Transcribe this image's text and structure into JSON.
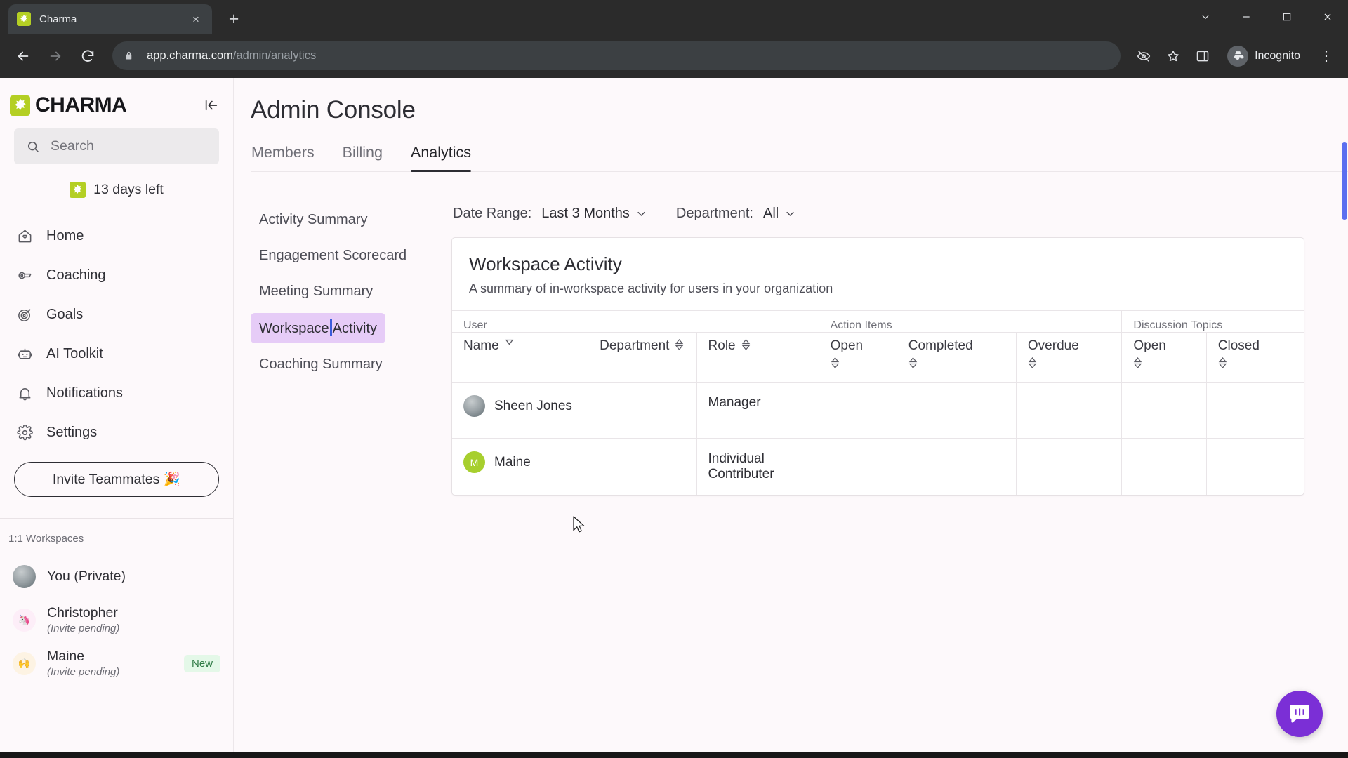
{
  "browser": {
    "tab_title": "Charma",
    "tab_close": "×",
    "new_tab": "+",
    "url_host": "app.charma.com",
    "url_path": "/admin/analytics",
    "profile_label": "Incognito",
    "kebab": "⋮",
    "icons": {
      "back": "back-arrow-icon",
      "forward": "forward-arrow-icon",
      "reload": "reload-icon",
      "lock": "lock-icon",
      "tracking": "tracking-protection-icon",
      "bookmark": "star-icon",
      "sidepanel": "side-panel-icon",
      "minimize": "minimize-icon",
      "maximize": "maximize-icon",
      "close": "window-close-icon",
      "tab_search": "tab-search-chevron-icon"
    }
  },
  "sidebar": {
    "brand": "CHARMA",
    "search_placeholder": "Search",
    "trial_text": "13 days left",
    "nav_items": [
      {
        "label": "Home",
        "icon": "home-icon"
      },
      {
        "label": "Coaching",
        "icon": "whistle-icon"
      },
      {
        "label": "Goals",
        "icon": "target-icon"
      },
      {
        "label": "AI Toolkit",
        "icon": "robot-icon"
      },
      {
        "label": "Notifications",
        "icon": "bell-icon"
      },
      {
        "label": "Settings",
        "icon": "gear-icon"
      }
    ],
    "invite_label": "Invite Teammates 🎉",
    "workspaces_title": "1:1 Workspaces",
    "workspaces": [
      {
        "name": "You (Private)",
        "sub": "",
        "badge": "",
        "avatar": "photo",
        "initial": ""
      },
      {
        "name": "Christopher",
        "sub": "(Invite pending)",
        "badge": "",
        "avatar": "pink",
        "initial": "🦄"
      },
      {
        "name": "Maine",
        "sub": "(Invite pending)",
        "badge": "New",
        "avatar": "yellow",
        "initial": "🙌"
      }
    ]
  },
  "main": {
    "page_title": "Admin Console",
    "tabs": [
      {
        "label": "Members",
        "active": false
      },
      {
        "label": "Billing",
        "active": false
      },
      {
        "label": "Analytics",
        "active": true
      }
    ],
    "subnav": [
      {
        "label": "Activity Summary",
        "selected": false
      },
      {
        "label": "Engagement Scorecard",
        "selected": false
      },
      {
        "label": "Meeting Summary",
        "selected": false
      },
      {
        "label": "Workspace Activity",
        "selected": true
      },
      {
        "label": "Coaching Summary",
        "selected": false
      }
    ],
    "filters": {
      "date_range_label": "Date Range:",
      "date_range_value": "Last 3 Months",
      "department_label": "Department:",
      "department_value": "All"
    },
    "card": {
      "title": "Workspace Activity",
      "subtitle": "A summary of in-workspace activity for users in your organization",
      "group_headers": [
        {
          "label": "User",
          "span": 3
        },
        {
          "label": "Action Items",
          "span": 3
        },
        {
          "label": "Discussion Topics",
          "span": 2
        }
      ],
      "columns": [
        {
          "label": "Name",
          "sort": "single-down"
        },
        {
          "label": "Department",
          "sort": "both"
        },
        {
          "label": "Role",
          "sort": "both"
        },
        {
          "label": "Open",
          "sort": "both"
        },
        {
          "label": "Completed",
          "sort": "both"
        },
        {
          "label": "Overdue",
          "sort": "both"
        },
        {
          "label": "Open",
          "sort": "both"
        },
        {
          "label": "Closed",
          "sort": "both"
        }
      ],
      "rows": [
        {
          "name": "Sheen Jones",
          "avatar": "photo",
          "initial": "",
          "department": "",
          "role": "Manager",
          "ai_open": "",
          "ai_completed": "",
          "ai_overdue": "",
          "dt_open": "",
          "dt_closed": ""
        },
        {
          "name": "Maine",
          "avatar": "green",
          "initial": "M",
          "department": "",
          "role": "Individual Contributer",
          "ai_open": "",
          "ai_completed": "",
          "ai_overdue": "",
          "dt_open": "",
          "dt_closed": ""
        }
      ]
    },
    "help_bubble_icon": "intercom-chat-icon"
  },
  "colors": {
    "brand_green": "#b4cf24",
    "selected_purple": "#e6ccf7",
    "accent_blue": "#3b5bdb",
    "intercom_purple": "#7b2fd6",
    "badge_green_bg": "#e4f8e8",
    "badge_green_text": "#2f7a45"
  }
}
